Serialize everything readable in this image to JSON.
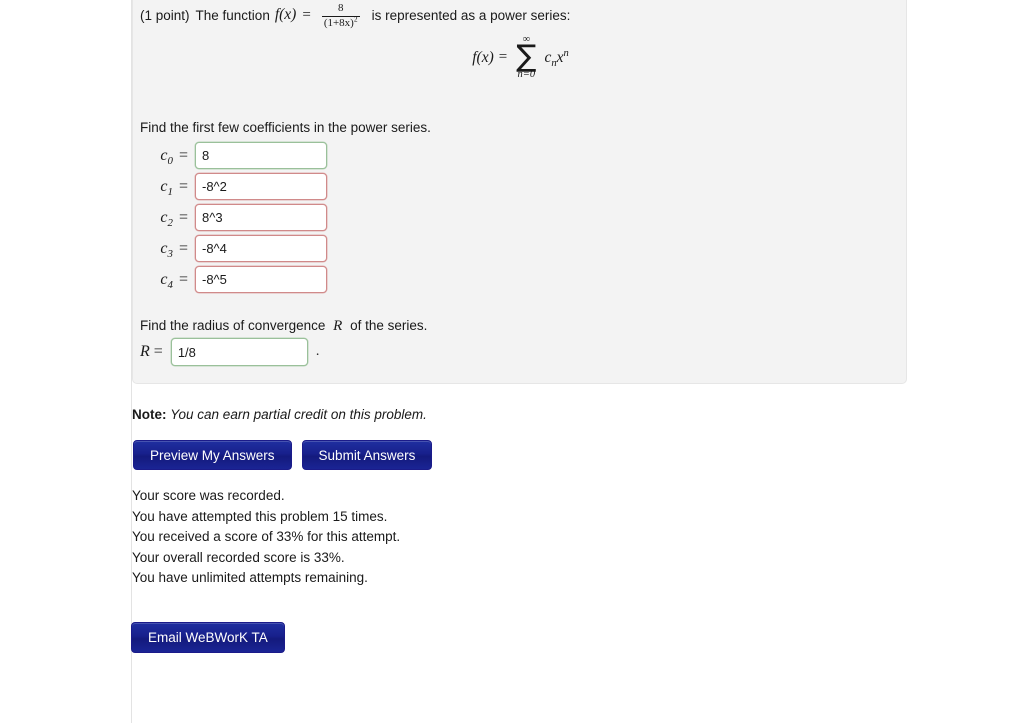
{
  "problem": {
    "points_label": "(1 point)",
    "intro_prefix": "The function",
    "function_name": "f(x)",
    "equals": "=",
    "fraction": {
      "numerator": "8",
      "denominator_base": "(1+8x)",
      "denominator_exponent": "2"
    },
    "intro_suffix": "is represented as a power series:",
    "series_display": {
      "lhs": "f(x)",
      "equals": "=",
      "sigma": "∑",
      "upper_limit": "∞",
      "lower_limit": "n=0",
      "term_c": "c",
      "term_c_sub": "n",
      "term_x": "x",
      "term_x_sup": "n"
    },
    "coefficients_prompt": "Find the first few coefficients in the power series.",
    "coefficients": [
      {
        "symbol": "c",
        "subscript": "0",
        "equals": "=",
        "value": "8",
        "state": "correct"
      },
      {
        "symbol": "c",
        "subscript": "1",
        "equals": "=",
        "value": "-8^2",
        "state": "incorrect"
      },
      {
        "symbol": "c",
        "subscript": "2",
        "equals": "=",
        "value": "8^3",
        "state": "incorrect"
      },
      {
        "symbol": "c",
        "subscript": "3",
        "equals": "=",
        "value": "-8^4",
        "state": "incorrect"
      },
      {
        "symbol": "c",
        "subscript": "4",
        "equals": "=",
        "value": "-8^5",
        "state": "incorrect"
      }
    ],
    "radius_prompt_prefix": "Find the radius of convergence",
    "radius_symbol": "R",
    "radius_prompt_suffix": "of the series.",
    "radius_label": "R",
    "radius_equals": "=",
    "radius_value": "1/8",
    "radius_period": "."
  },
  "note": {
    "label": "Note:",
    "text": "You can earn partial credit on this problem."
  },
  "buttons": {
    "preview": "Preview My Answers",
    "submit": "Submit Answers",
    "email": "Email WeBWorK TA"
  },
  "status_messages": [
    "Your score was recorded.",
    "You have attempted this problem 15 times.",
    "You received a score of 33% for this attempt.",
    "Your overall recorded score is 33%.",
    "You have unlimited attempts remaining."
  ],
  "colors": {
    "panel_background": "#f3f3f3",
    "page_background": "#ffffff",
    "button_blue": "#18208c",
    "correct_border": "#9ac09a",
    "incorrect_border": "#d08a8a"
  }
}
